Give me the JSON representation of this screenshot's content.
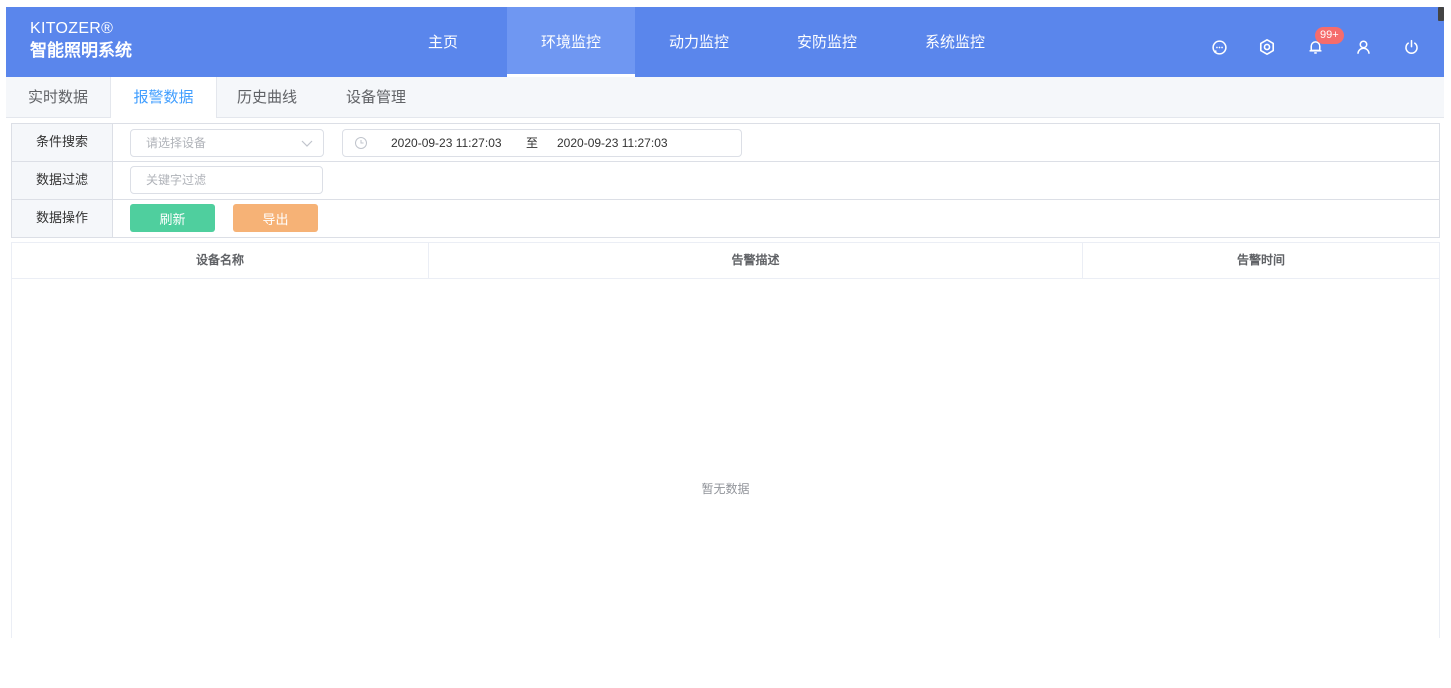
{
  "app": {
    "brand_en": "KITOZER®",
    "brand_cn": "智能照明系统",
    "accent_color": "#5a86ec"
  },
  "nav": {
    "items": [
      {
        "label": "主页"
      },
      {
        "label": "环境监控"
      },
      {
        "label": "动力监控"
      },
      {
        "label": "安防监控"
      },
      {
        "label": "系统监控"
      }
    ],
    "active": "环境监控"
  },
  "header_icons": {
    "message_icon": "chat-bubble-icon",
    "settings_icon": "gear-icon",
    "notification_icon": "bell-icon",
    "notification_badge": "99+",
    "user_icon": "user-icon",
    "power_icon": "power-icon"
  },
  "tabs": {
    "items": [
      {
        "label": "实时数据"
      },
      {
        "label": "报警数据"
      },
      {
        "label": "历史曲线"
      },
      {
        "label": "设备管理"
      }
    ],
    "active": "报警数据"
  },
  "filters": {
    "search_label": "条件搜索",
    "device_placeholder": "请选择设备",
    "date_start": "2020-09-23 11:27:03",
    "date_separator": "至",
    "date_end": "2020-09-23 11:27:03",
    "filter_label": "数据过滤",
    "keyword_placeholder": "关键字过滤",
    "ops_label": "数据操作",
    "refresh_label": "刷新",
    "export_label": "导出"
  },
  "table": {
    "columns": [
      {
        "label": "设备名称"
      },
      {
        "label": "告警描述"
      },
      {
        "label": "告警时间"
      }
    ],
    "rows": [],
    "empty_text": "暂无数据"
  }
}
